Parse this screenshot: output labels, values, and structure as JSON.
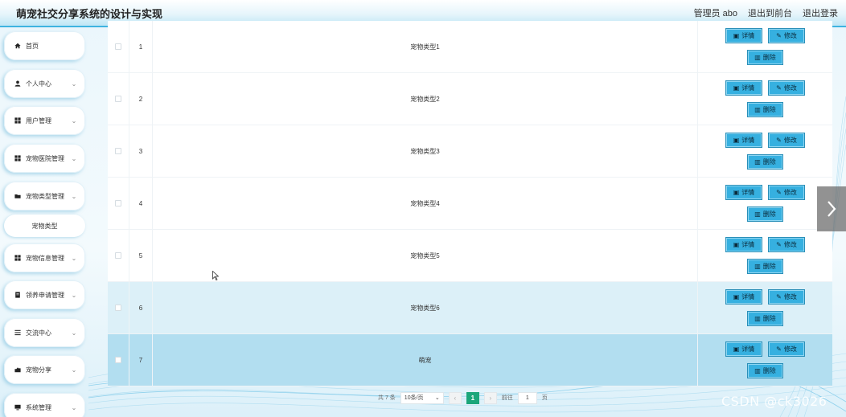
{
  "header": {
    "title": "萌宠社交分享系统的设计与实现",
    "admin_label": "管理员 abo",
    "to_frontend": "退出到前台",
    "logout": "退出登录"
  },
  "sidebar": {
    "items": [
      {
        "label": "首页",
        "icon": "home-icon",
        "chevron": false
      },
      {
        "label": "个人中心",
        "icon": "user-icon",
        "chevron": true
      },
      {
        "label": "用户管理",
        "icon": "grid-icon",
        "chevron": true
      },
      {
        "label": "宠物医院管理",
        "icon": "grid-icon",
        "chevron": true
      },
      {
        "label": "宠物类型管理",
        "icon": "folder-icon",
        "chevron": true
      },
      {
        "label": "宠物信息管理",
        "icon": "grid-icon",
        "chevron": true
      },
      {
        "label": "领养申请管理",
        "icon": "document-icon",
        "chevron": true
      },
      {
        "label": "交流中心",
        "icon": "list-icon",
        "chevron": true
      },
      {
        "label": "宠物分享",
        "icon": "share-icon",
        "chevron": true
      },
      {
        "label": "系统管理",
        "icon": "monitor-icon",
        "chevron": true
      }
    ],
    "sub_item": "宠物类型"
  },
  "table": {
    "rows": [
      {
        "index": "1",
        "name": "宠物类型1"
      },
      {
        "index": "2",
        "name": "宠物类型2"
      },
      {
        "index": "3",
        "name": "宠物类型3"
      },
      {
        "index": "4",
        "name": "宠物类型4"
      },
      {
        "index": "5",
        "name": "宠物类型5"
      },
      {
        "index": "6",
        "name": "宠物类型6"
      },
      {
        "index": "7",
        "name": "萌宠"
      }
    ],
    "buttons": {
      "detail": "详情",
      "edit": "修改",
      "delete": "删除"
    }
  },
  "pagination": {
    "total": "共 7 条",
    "page_size": "10条/页",
    "current_page": "1",
    "goto_label": "前往",
    "goto_value": "1",
    "page_suffix": "页"
  },
  "watermark": "CSDN @ck3026",
  "colors": {
    "accent": "#36b0e0",
    "header_border": "#3fb3e0",
    "row_highlight_1": "#dcf0f8",
    "row_highlight_2": "#b2def0",
    "page_current": "#1aa67a"
  }
}
